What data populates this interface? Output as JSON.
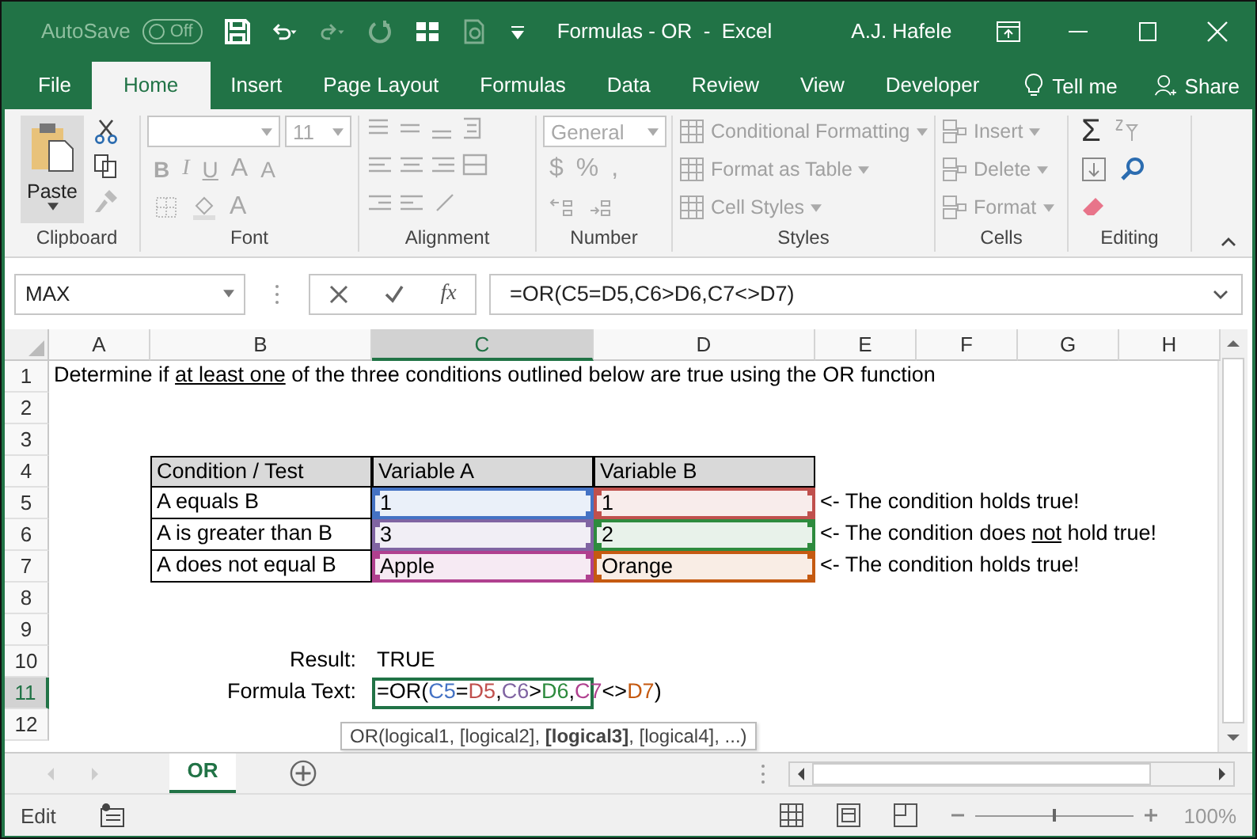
{
  "title_bar": {
    "autosave_label": "AutoSave",
    "autosave_toggle": {
      "label": "Off",
      "on": false
    },
    "title": "Formulas - OR  -  Excel",
    "user": "A.J. Hafele"
  },
  "tabs": [
    {
      "label": "File",
      "selected": false
    },
    {
      "label": "Home",
      "selected": true
    },
    {
      "label": "Insert",
      "selected": false
    },
    {
      "label": "Page Layout",
      "selected": false
    },
    {
      "label": "Formulas",
      "selected": false
    },
    {
      "label": "Data",
      "selected": false
    },
    {
      "label": "Review",
      "selected": false
    },
    {
      "label": "View",
      "selected": false
    },
    {
      "label": "Developer",
      "selected": false
    }
  ],
  "tell_me": "Tell me",
  "share": "Share",
  "ribbon": {
    "disabled": true,
    "clipboard": {
      "paste": "Paste",
      "label": "Clipboard"
    },
    "font": {
      "font_size": "11",
      "bold": "B",
      "italic": "I",
      "underline": "U",
      "grow": "A",
      "shrink": "A",
      "font_color": "A",
      "label": "Font"
    },
    "alignment": {
      "label": "Alignment"
    },
    "number": {
      "format": "General",
      "currency": "$",
      "percent": "%",
      "comma": ",",
      "label": "Number"
    },
    "styles": {
      "label": "Styles",
      "items": [
        {
          "label": "Conditional Formatting",
          "disabled": true
        },
        {
          "label": "Format as Table",
          "disabled": true
        },
        {
          "label": "Cell Styles",
          "disabled": true
        }
      ]
    },
    "cells": {
      "label": "Cells",
      "items": [
        {
          "label": "Insert",
          "disabled": true
        },
        {
          "label": "Delete",
          "disabled": true
        },
        {
          "label": "Format",
          "disabled": true
        }
      ]
    },
    "editing": {
      "sum": "Σ",
      "label": "Editing"
    }
  },
  "formula_bar": {
    "name_box": "MAX",
    "fx": "fx",
    "formula": "=OR(C5=D5,C6>D6,C7<>D7)"
  },
  "sheet": {
    "columns": [
      {
        "label": "A",
        "selected": false
      },
      {
        "label": "B",
        "selected": false
      },
      {
        "label": "C",
        "selected": true
      },
      {
        "label": "D",
        "selected": false
      },
      {
        "label": "E",
        "selected": false
      },
      {
        "label": "F",
        "selected": false
      },
      {
        "label": "G",
        "selected": false
      },
      {
        "label": "H",
        "selected": false
      }
    ],
    "rows": [
      {
        "label": "1",
        "selected": false,
        "cells": [
          {
            "kind": "note",
            "parts": [
              {
                "text": "Determine if ",
                "underline": false
              },
              {
                "text": "at least one",
                "underline": true
              },
              {
                "text": " of the three conditions outlined below are true using the OR function",
                "underline": false
              }
            ]
          }
        ]
      },
      {
        "label": "2",
        "selected": false
      },
      {
        "label": "3",
        "selected": false
      },
      {
        "label": "4",
        "selected": false,
        "cells": [
          {
            "kind": "empty"
          },
          {
            "kind": "header",
            "text": "Condition / Test"
          },
          {
            "kind": "header",
            "text": "Variable A"
          },
          {
            "kind": "header",
            "text": "Variable B"
          }
        ]
      },
      {
        "label": "5",
        "selected": false,
        "cells": [
          {
            "kind": "empty"
          },
          {
            "kind": "text",
            "text": "A equals B"
          },
          {
            "kind": "range",
            "text": "1",
            "color": "#4472c4"
          },
          {
            "kind": "range",
            "text": "1",
            "color": "#c0504d"
          },
          {
            "kind": "note",
            "parts": [
              {
                "text": "<- The condition holds true!",
                "underline": false
              }
            ]
          }
        ]
      },
      {
        "label": "6",
        "selected": false,
        "cells": [
          {
            "kind": "empty"
          },
          {
            "kind": "text",
            "text": "A is greater than B"
          },
          {
            "kind": "range",
            "text": "3",
            "color": "#8064a2"
          },
          {
            "kind": "range",
            "text": "2",
            "color": "#2e8b3e"
          },
          {
            "kind": "note",
            "parts": [
              {
                "text": "<- The condition does ",
                "underline": false
              },
              {
                "text": "not",
                "underline": true
              },
              {
                "text": " hold true!",
                "underline": false
              }
            ]
          }
        ]
      },
      {
        "label": "7",
        "selected": false,
        "cells": [
          {
            "kind": "empty"
          },
          {
            "kind": "text",
            "text": "A does not equal B"
          },
          {
            "kind": "range",
            "text": "Apple",
            "color": "#b0408f"
          },
          {
            "kind": "range",
            "text": "Orange",
            "color": "#c55a11"
          },
          {
            "kind": "note",
            "parts": [
              {
                "text": "<- The condition holds true!",
                "underline": false
              }
            ]
          }
        ]
      },
      {
        "label": "8",
        "selected": false
      },
      {
        "label": "9",
        "selected": false
      },
      {
        "label": "10",
        "selected": false,
        "cells": [
          {
            "kind": "empty"
          },
          {
            "kind": "label",
            "text": "Result:"
          },
          {
            "kind": "value",
            "text": "TRUE"
          }
        ]
      },
      {
        "label": "11",
        "selected": true,
        "cells": [
          {
            "kind": "empty"
          },
          {
            "kind": "label",
            "text": "Formula Text:"
          },
          {
            "kind": "formula",
            "parts": [
              {
                "text": "=OR(",
                "color": "#000000"
              },
              {
                "text": "C5",
                "color": "#4472c4"
              },
              {
                "text": "=",
                "color": "#000000"
              },
              {
                "text": "D5",
                "color": "#c0504d"
              },
              {
                "text": ",",
                "color": "#000000"
              },
              {
                "text": "C6",
                "color": "#8064a2"
              },
              {
                "text": ">",
                "color": "#000000"
              },
              {
                "text": "D6",
                "color": "#2e8b3e"
              },
              {
                "text": ",",
                "color": "#000000"
              },
              {
                "text": "C7",
                "color": "#b0408f"
              },
              {
                "text": "<>",
                "color": "#000000"
              },
              {
                "text": "D7",
                "color": "#c55a11"
              },
              {
                "text": ")",
                "color": "#000000"
              }
            ]
          }
        ]
      },
      {
        "label": "12",
        "selected": false
      }
    ],
    "tooltip": "OR(logical1, [logical2], **[logical3]**, [logical4], ...)"
  },
  "sheet_tabs": [
    {
      "label": "OR",
      "selected": true
    }
  ],
  "status_bar": {
    "mode": "Edit",
    "zoom": {
      "level": 0.5
    },
    "zoom_label": "100%"
  }
}
